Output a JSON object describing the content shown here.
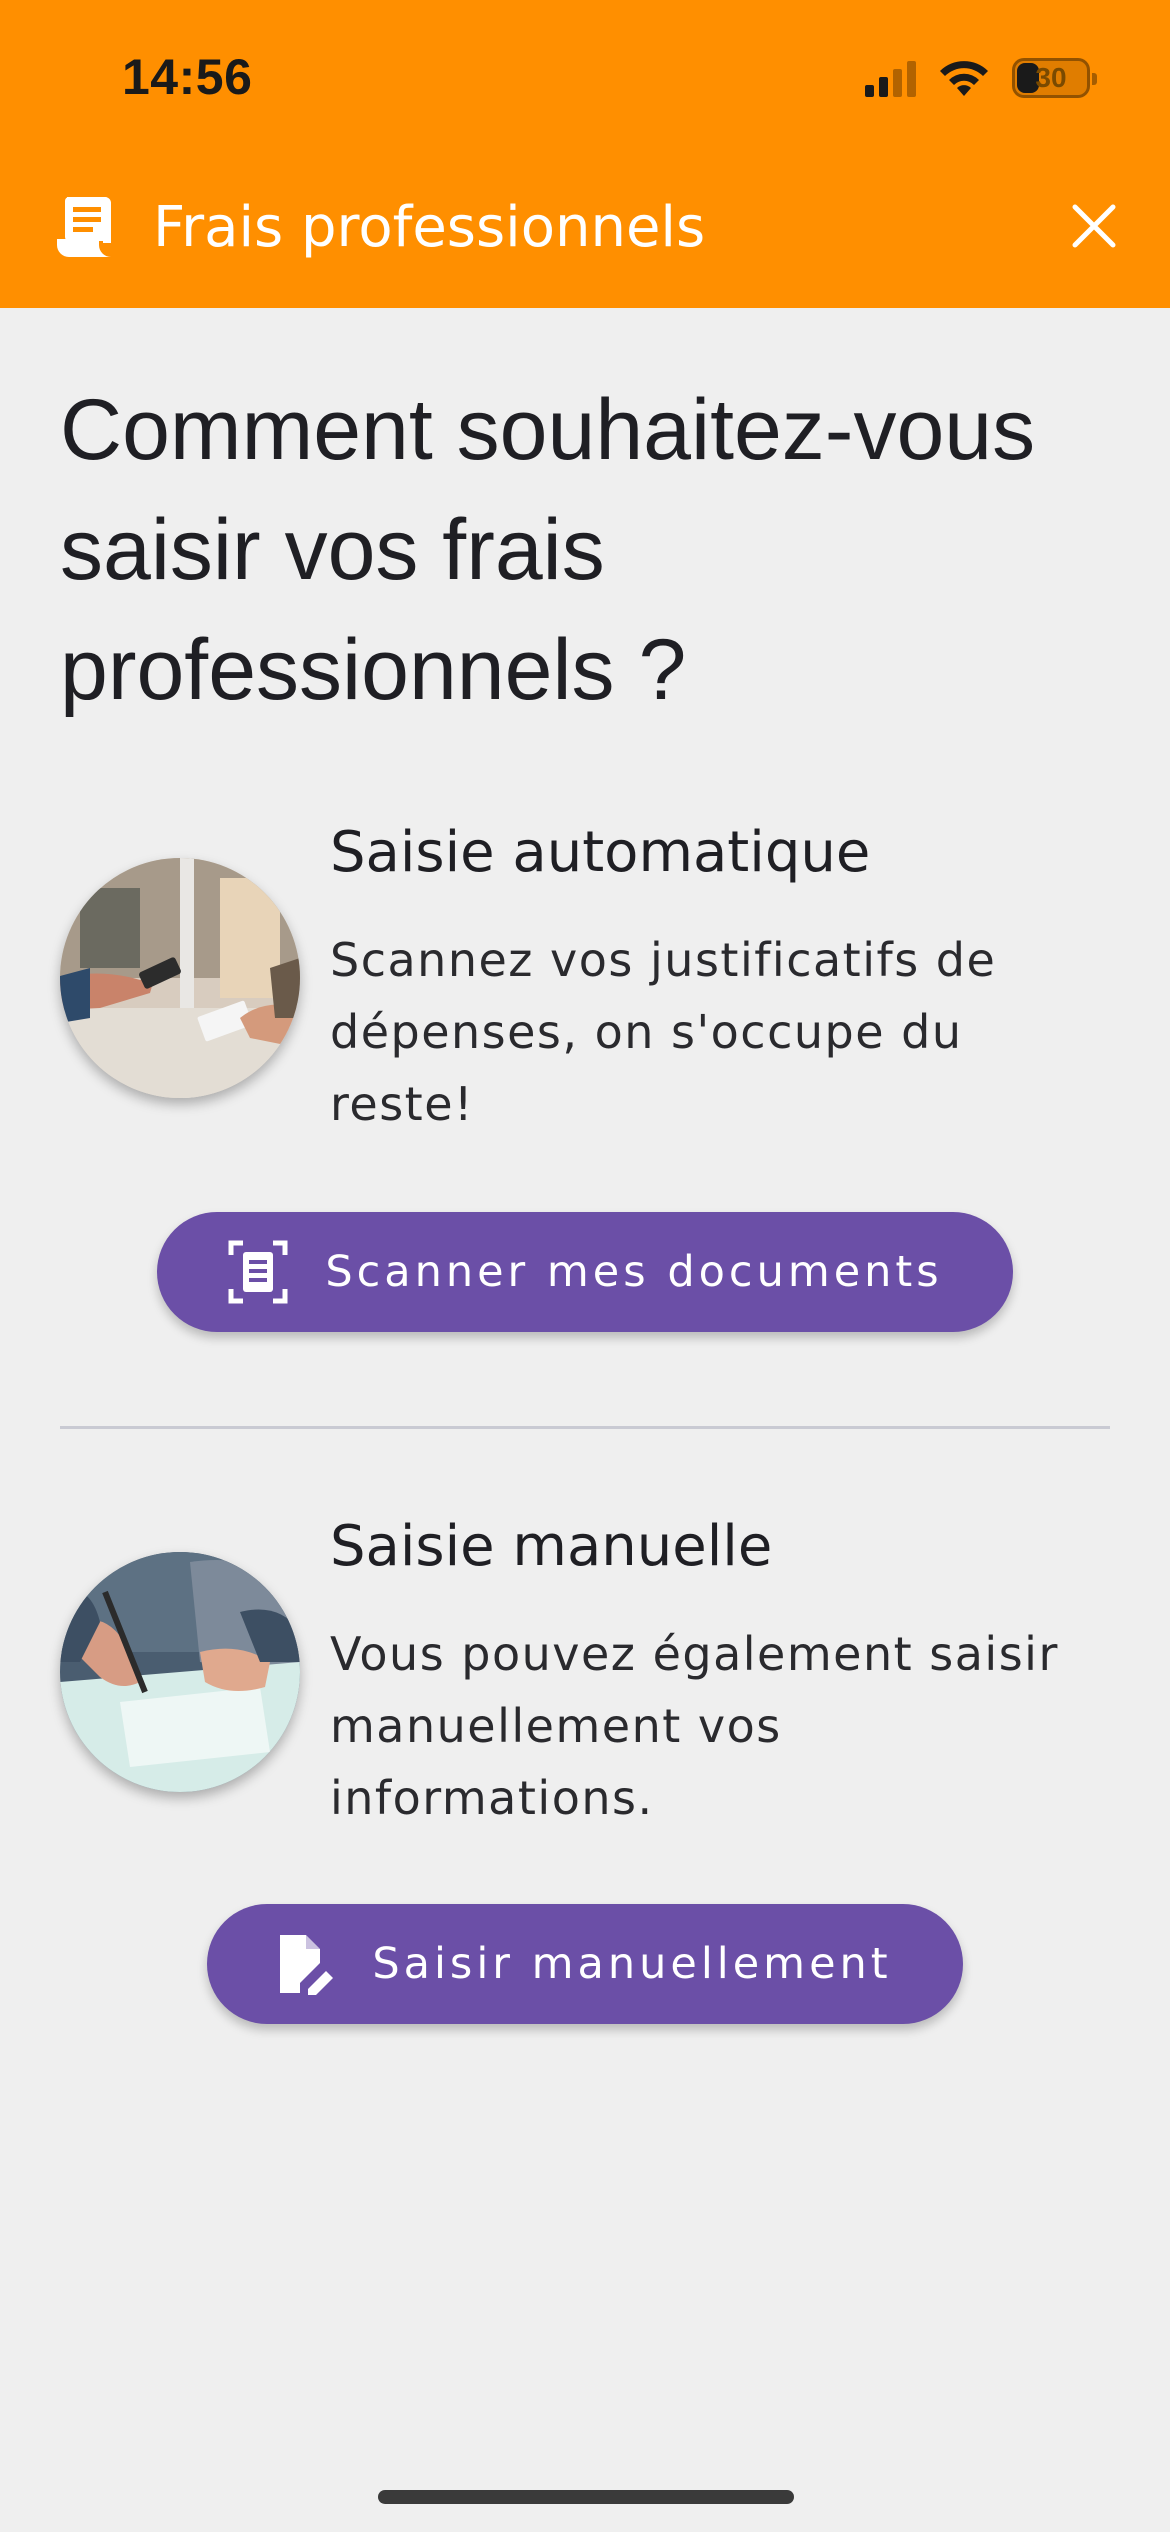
{
  "status_bar": {
    "time": "14:56",
    "battery": "30"
  },
  "header": {
    "title": "Frais professionnels",
    "icon": "receipt-icon",
    "close_icon": "close-icon",
    "background": "#ff8f00"
  },
  "question": "Comment souhaitez-vous saisir vos frais professionnels ?",
  "options": [
    {
      "title": "Saisie automatique",
      "description": "Scannez vos justificatifs de dépenses, on s'occupe du reste!",
      "button_label": "Scanner mes documents",
      "button_icon": "document-scanner-icon"
    },
    {
      "title": "Saisie manuelle",
      "description": "Vous pouvez également saisir manuellement vos informations.",
      "button_label": "Saisir manuellement",
      "button_icon": "edit-document-icon"
    }
  ],
  "colors": {
    "accent": "#6b4fa7",
    "header": "#ff8f00",
    "background": "#efefef"
  }
}
